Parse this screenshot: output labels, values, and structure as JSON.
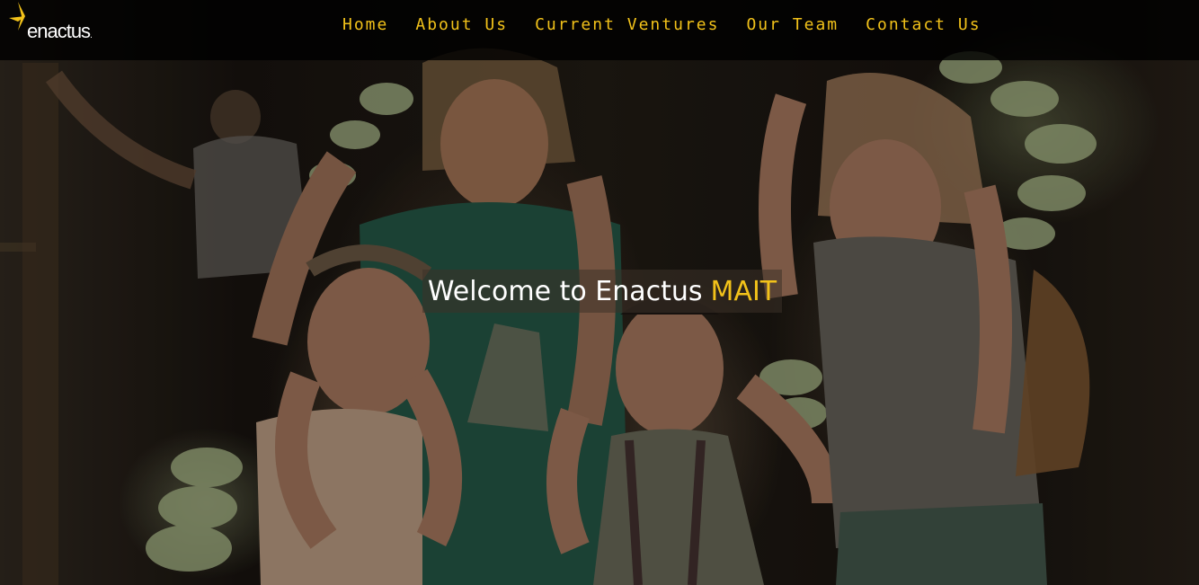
{
  "brand": {
    "logo_text": "enactus",
    "logo_dot": ".",
    "accent_color": "#f2c21a"
  },
  "nav": {
    "items": [
      {
        "label": "Home"
      },
      {
        "label": "About Us"
      },
      {
        "label": "Current Ventures"
      },
      {
        "label": "Our Team"
      },
      {
        "label": "Contact Us"
      }
    ]
  },
  "hero": {
    "welcome_text": "Welcome to Enactus",
    "welcome_accent": "MAIT",
    "image_subject": "hero-photo"
  }
}
